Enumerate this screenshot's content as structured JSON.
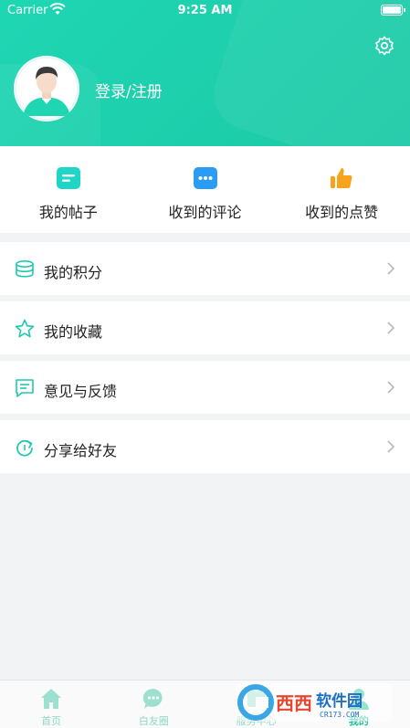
{
  "status_bar": {
    "carrier": "Carrier",
    "time": "9:25 AM"
  },
  "header": {
    "login_label": "登录/注册",
    "accent": "#1fd6b3"
  },
  "quick_actions": [
    {
      "label": "我的帖子",
      "icon": "post-icon",
      "color": "#1fd6c6"
    },
    {
      "label": "收到的评论",
      "icon": "comment-icon",
      "color": "#2a9cf5"
    },
    {
      "label": "收到的点赞",
      "icon": "thumbs-up-icon",
      "color": "#f7a31c"
    }
  ],
  "menu": [
    {
      "label": "我的积分",
      "icon": "coins-icon"
    },
    {
      "label": "我的收藏",
      "icon": "star-icon"
    },
    {
      "label": "意见与反馈",
      "icon": "feedback-icon"
    },
    {
      "label": "分享给好友",
      "icon": "share-icon"
    }
  ],
  "tabbar": [
    {
      "label": "首页",
      "icon": "home-icon",
      "active": false
    },
    {
      "label": "白友圈",
      "icon": "chat-icon",
      "active": false
    },
    {
      "label": "服务中心",
      "icon": "service-icon",
      "active": false
    },
    {
      "label": "我的",
      "icon": "profile-icon",
      "active": true
    }
  ],
  "watermark": {
    "brand": "西西软件园",
    "domain": "CR173.COM"
  }
}
